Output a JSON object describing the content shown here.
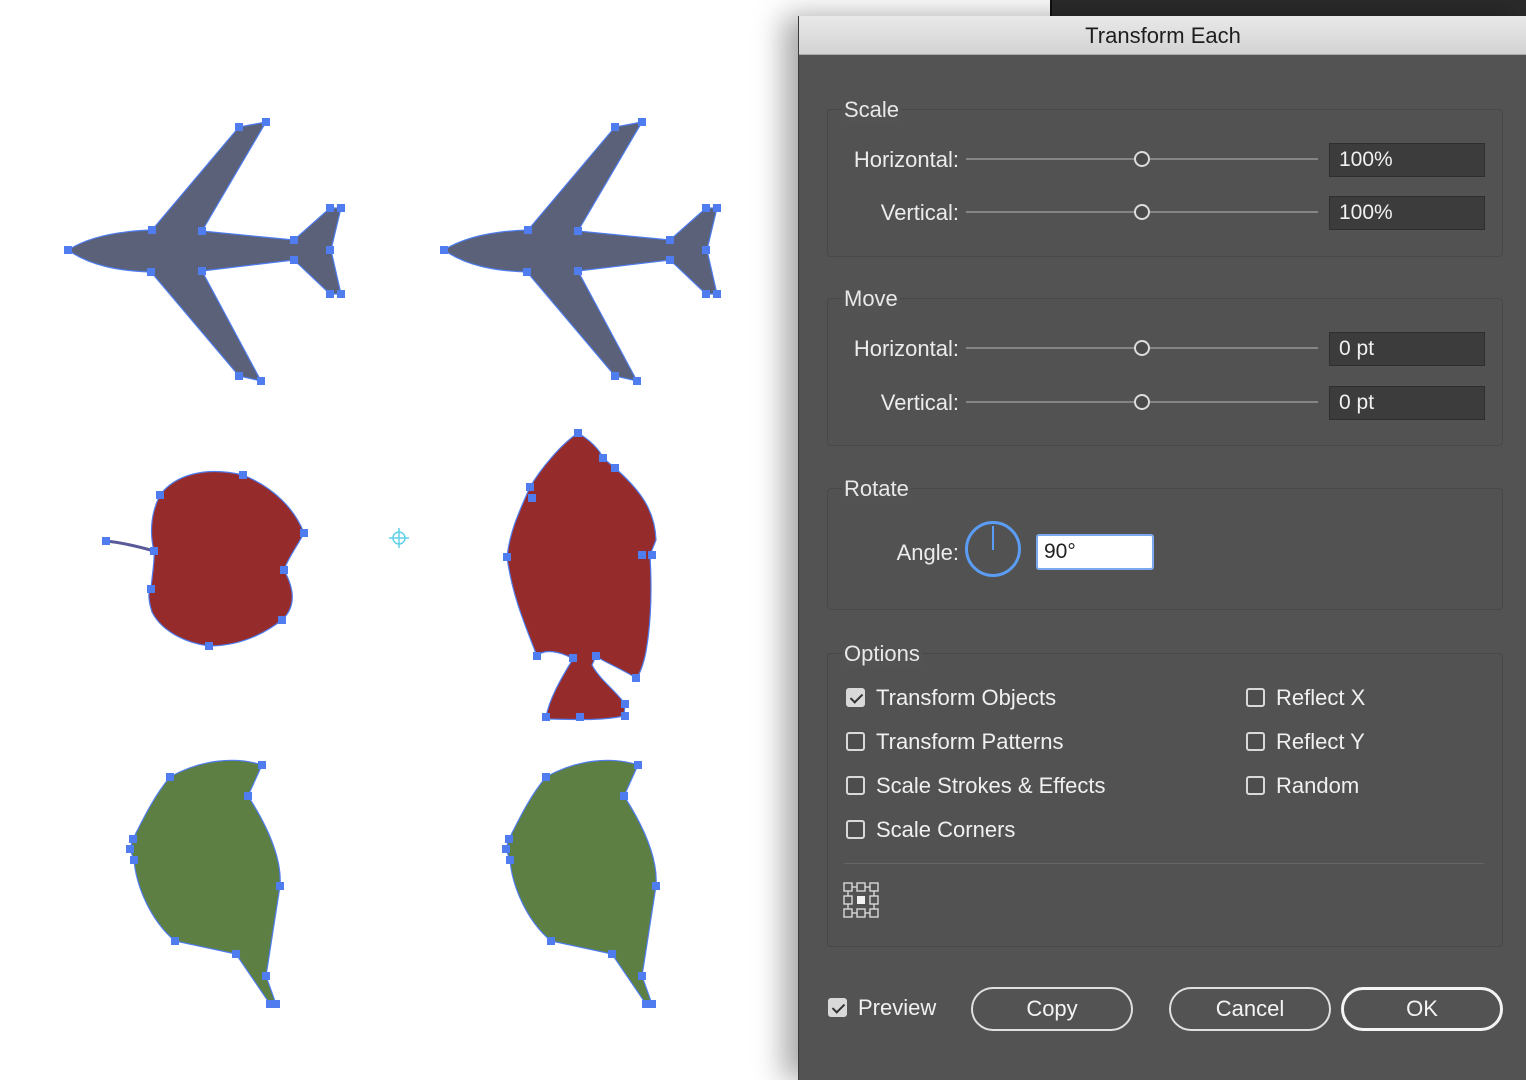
{
  "dialog": {
    "title": "Transform Each",
    "scale": {
      "title": "Scale",
      "horizontal_label": "Horizontal:",
      "horizontal_value": "100%",
      "horizontal_slider_fraction": 0.5,
      "vertical_label": "Vertical:",
      "vertical_value": "100%",
      "vertical_slider_fraction": 0.5
    },
    "move": {
      "title": "Move",
      "horizontal_label": "Horizontal:",
      "horizontal_value": "0 pt",
      "horizontal_slider_fraction": 0.5,
      "vertical_label": "Vertical:",
      "vertical_value": "0 pt",
      "vertical_slider_fraction": 0.5
    },
    "rotate": {
      "title": "Rotate",
      "angle_label": "Angle:",
      "angle_value": "90°"
    },
    "options": {
      "title": "Options",
      "checkboxes": [
        {
          "label": "Transform Objects",
          "checked": true
        },
        {
          "label": "Transform Patterns",
          "checked": false
        },
        {
          "label": "Scale Strokes & Effects",
          "checked": false
        },
        {
          "label": "Scale Corners",
          "checked": false
        },
        {
          "label": "Reflect X",
          "checked": false
        },
        {
          "label": "Reflect Y",
          "checked": false
        },
        {
          "label": "Random",
          "checked": false
        }
      ],
      "reference_point": "center"
    },
    "preview": {
      "label": "Preview",
      "checked": true
    },
    "buttons": {
      "copy": "Copy",
      "cancel": "Cancel",
      "ok": "OK"
    }
  },
  "canvas": {
    "selection_color": "#4f7df0",
    "shapes": [
      {
        "name": "airplane-original",
        "color": "#5a6178"
      },
      {
        "name": "airplane-transformed",
        "color": "#5a6178"
      },
      {
        "name": "apple-original",
        "color": "#962b2b"
      },
      {
        "name": "apple-rotated",
        "color": "#962b2b"
      },
      {
        "name": "leaf-original",
        "color": "#5d7f43"
      },
      {
        "name": "leaf-transformed",
        "color": "#5d7f43"
      }
    ]
  }
}
